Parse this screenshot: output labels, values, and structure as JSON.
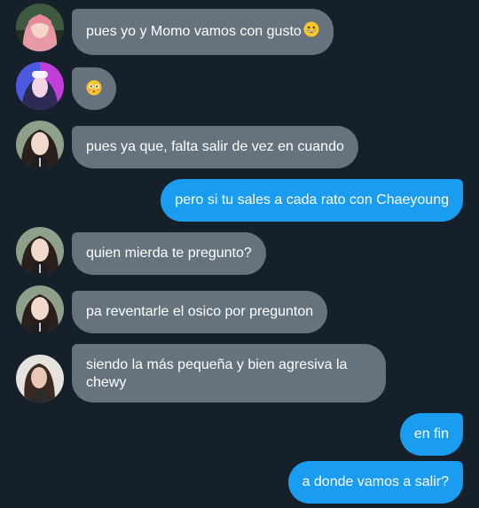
{
  "messages": [
    {
      "side": "incoming",
      "avatar": "pink-hair-avatar",
      "text": "pues yo y Momo vamos con gusto",
      "emoji": "grinning-face-icon"
    },
    {
      "side": "incoming",
      "avatar": "neon-avatar",
      "text": "",
      "emoji": "flushed-face-icon"
    },
    {
      "side": "incoming",
      "avatar": "dark-hair-avatar",
      "text": "pues ya que, falta salir de vez en cuando"
    },
    {
      "side": "outgoing",
      "text": "pero si tu sales a cada rato con Chaeyoung"
    },
    {
      "side": "incoming",
      "avatar": "dark-hair-avatar",
      "text": "quien mierda te pregunto?"
    },
    {
      "side": "incoming",
      "avatar": "dark-hair-avatar",
      "text": "pa reventarle el osico por pregunton"
    },
    {
      "side": "incoming",
      "avatar": "long-hair-avatar",
      "text": "siendo la más pequeña y bien agresiva la chewy"
    },
    {
      "side": "outgoing",
      "text": "en fin"
    },
    {
      "side": "outgoing",
      "text": "a donde vamos a salir?"
    }
  ],
  "colors": {
    "background": "#16202b",
    "incoming_bubble": "#66737f",
    "outgoing_bubble": "#1a9cf0",
    "text": "#ffffff"
  }
}
